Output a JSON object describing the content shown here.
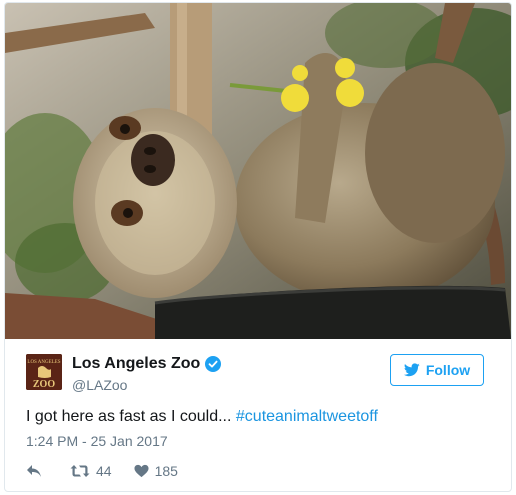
{
  "tweet": {
    "author_name": "Los Angeles Zoo",
    "handle": "@LAZoo",
    "follow_label": "Follow",
    "text_prefix": "I got here as fast as I could... ",
    "hashtag": "#cuteanimaltweetoff",
    "timestamp": "1:24 PM - 25 Jan 2017",
    "retweet_count": "44",
    "like_count": "185",
    "avatar_logo": {
      "top": "LOS ANGELES",
      "bottom": "ZOO"
    }
  },
  "icons": {
    "verified": "verified-badge-icon",
    "bird": "twitter-bird-icon",
    "reply": "reply-icon",
    "retweet": "retweet-icon",
    "like": "heart-icon"
  },
  "colors": {
    "accent": "#1da1f2",
    "hashtag": "#1b95e0",
    "muted": "#657786",
    "avatar_bg": "#5a2416"
  }
}
